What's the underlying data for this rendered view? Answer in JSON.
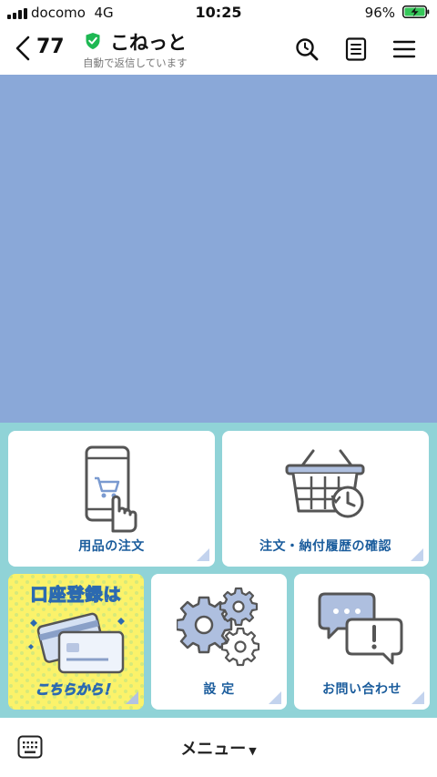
{
  "status_bar": {
    "carrier": "docomo",
    "network": "4G",
    "time": "10:25",
    "battery": "96%"
  },
  "header": {
    "back_count": "77",
    "title": "こねっと",
    "subtitle": "自動で返信しています",
    "icons": [
      "search-icon",
      "notes-icon",
      "menu-icon"
    ]
  },
  "rich_menu": {
    "tiles": [
      {
        "label": "用品の注文",
        "icon": "phone-cart-icon"
      },
      {
        "label": "注文・納付履歴の確認",
        "icon": "basket-history-icon"
      },
      {
        "label": "設 定",
        "icon": "gears-icon"
      },
      {
        "label": "お問い合わせ",
        "icon": "chat-bubbles-icon"
      }
    ],
    "promo": {
      "title": "口座登録は",
      "footer": "こちらから！"
    }
  },
  "bottom_bar": {
    "menu_label": "メニュー"
  },
  "colors": {
    "chat_background": "#8aa8d8",
    "menu_background": "#90d3d7",
    "label_blue": "#1a5c9c",
    "promo_yellow": "#fbf26a",
    "verified_green": "#1eb853"
  }
}
